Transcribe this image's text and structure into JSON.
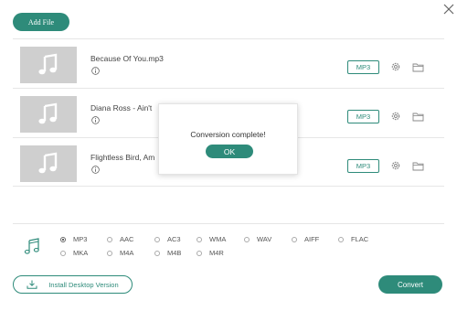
{
  "toolbar": {
    "add_file_label": "Add File"
  },
  "files": [
    {
      "name": "Because Of You.mp3",
      "format": "MP3"
    },
    {
      "name": "Diana Ross - Ain't",
      "format": "MP3"
    },
    {
      "name": "Flightless Bird, Am",
      "format": "MP3"
    }
  ],
  "dialog": {
    "message": "Conversion complete!",
    "ok_label": "OK"
  },
  "formats": {
    "selected": "MP3",
    "row1": [
      "MP3",
      "AAC",
      "AC3",
      "WMA",
      "WAV",
      "AIFF",
      "FLAC"
    ],
    "row2": [
      "MKA",
      "M4A",
      "M4B",
      "M4R"
    ]
  },
  "footer": {
    "install_label": "Install Desktop Version",
    "convert_label": "Convert"
  },
  "colors": {
    "accent": "#2e8b7a"
  }
}
